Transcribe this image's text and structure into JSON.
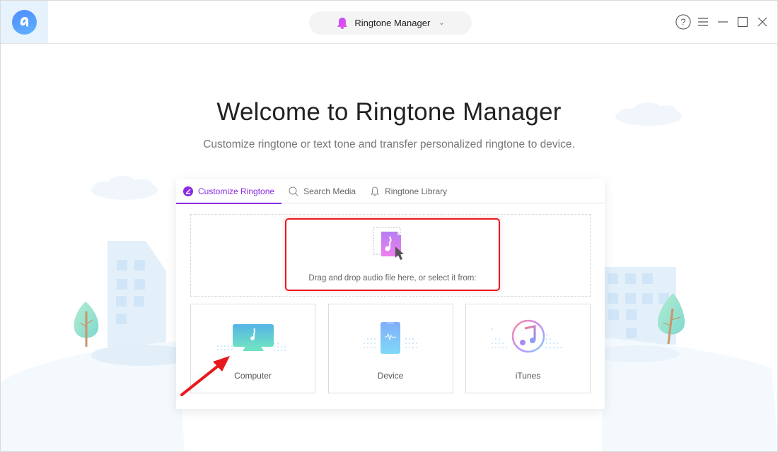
{
  "app": {
    "mode_selector": {
      "label": "Ringtone Manager",
      "icon": "bell-icon"
    },
    "window_controls": [
      {
        "name": "help",
        "icon": "help-icon"
      },
      {
        "name": "menu",
        "icon": "menu-icon"
      },
      {
        "name": "minimize",
        "icon": "minimize-icon"
      },
      {
        "name": "maximize",
        "icon": "maximize-icon"
      },
      {
        "name": "close",
        "icon": "close-icon"
      }
    ]
  },
  "hero": {
    "title": "Welcome to Ringtone Manager",
    "subtitle": "Customize ringtone or text tone and transfer personalized ringtone to device."
  },
  "tabs": [
    {
      "label": "Customize Ringtone",
      "icon": "edit-icon",
      "active": true
    },
    {
      "label": "Search Media",
      "icon": "search-icon",
      "active": false
    },
    {
      "label": "Ringtone Library",
      "icon": "bell-outline-icon",
      "active": false
    }
  ],
  "dropzone": {
    "text": "Drag and drop audio file here, or select it from:"
  },
  "sources": [
    {
      "label": "Computer",
      "icon": "computer-icon"
    },
    {
      "label": "Device",
      "icon": "phone-icon"
    },
    {
      "label": "iTunes",
      "icon": "itunes-icon"
    }
  ],
  "colors": {
    "accent": "#8a2be2",
    "annotation": "#e8191c",
    "logo": "#4f8bff"
  }
}
